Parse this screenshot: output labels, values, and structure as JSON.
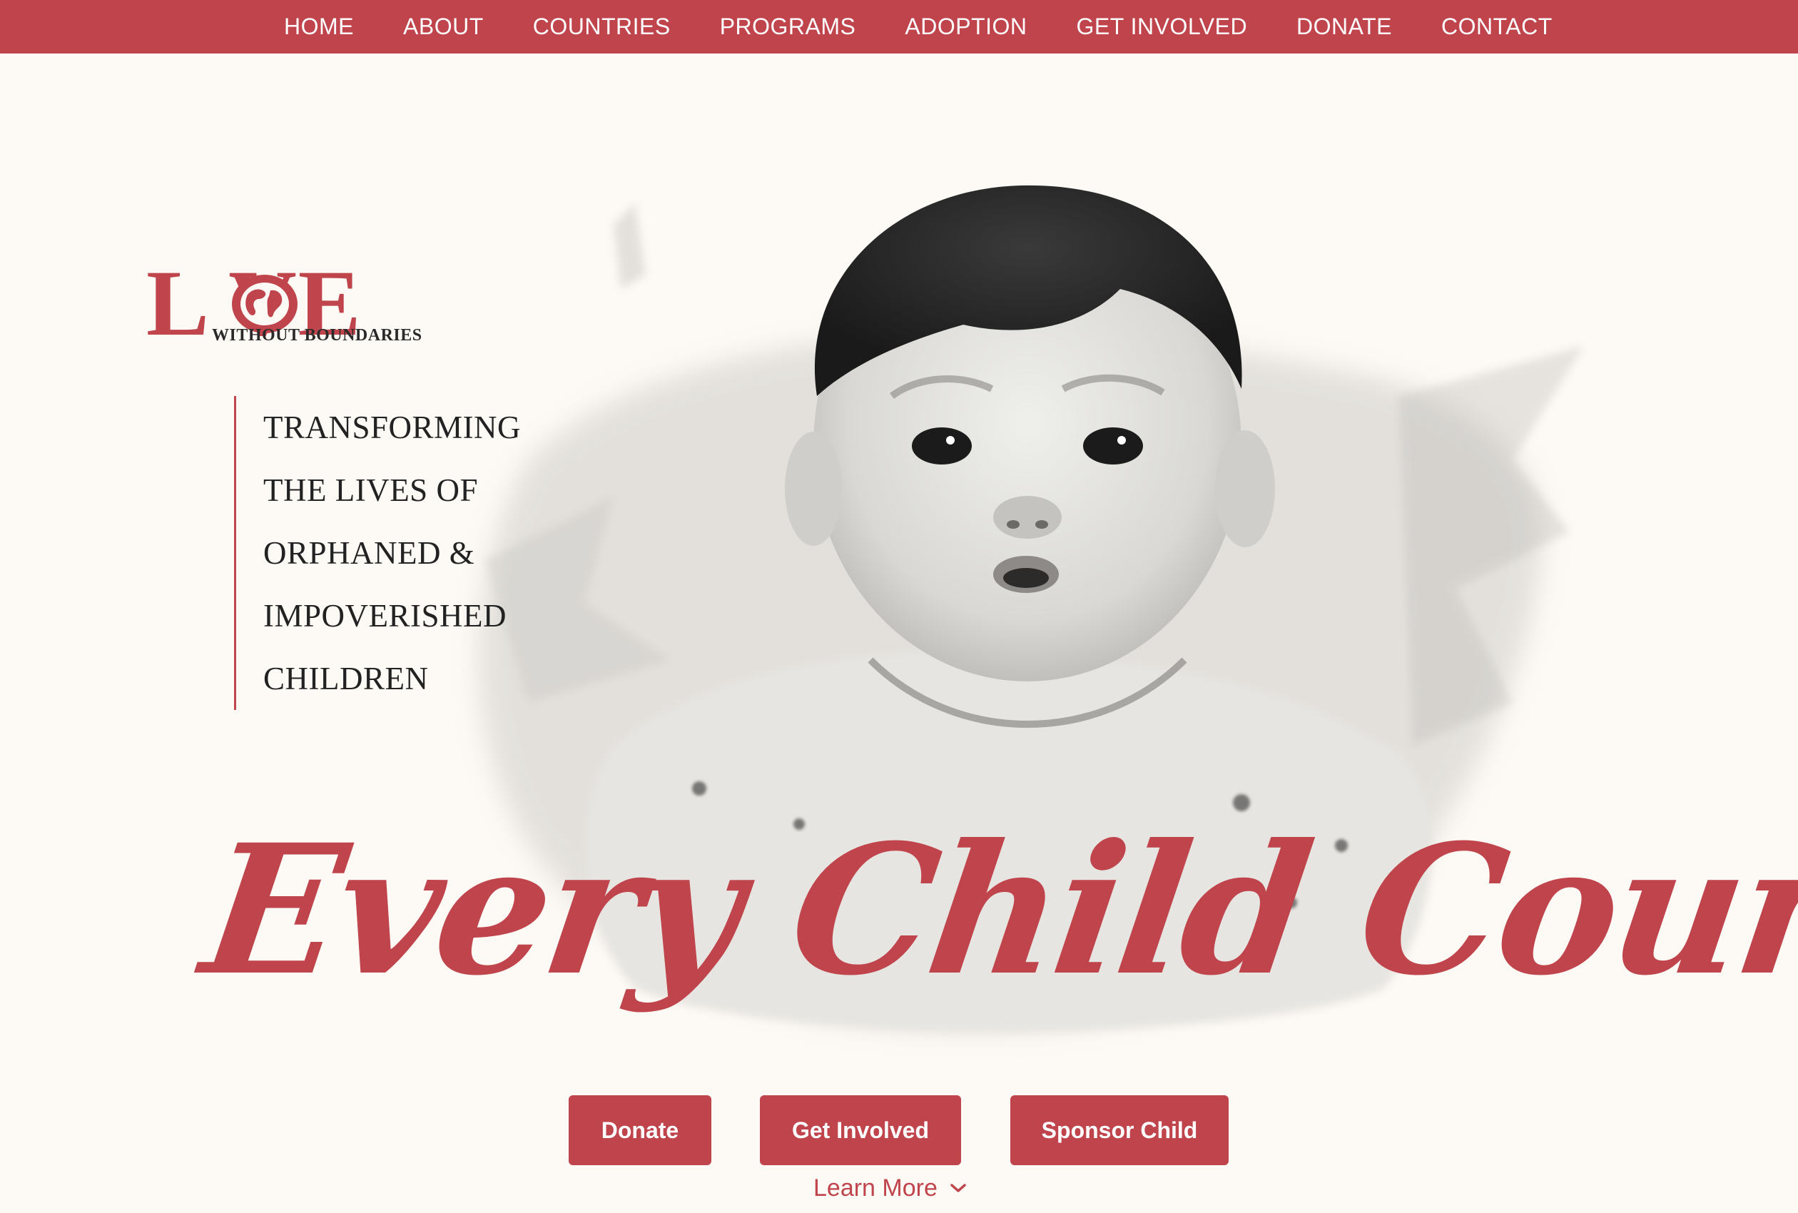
{
  "nav": {
    "items": [
      "HOME",
      "ABOUT",
      "COUNTRIES",
      "PROGRAMS",
      "ADOPTION",
      "GET INVOLVED",
      "DONATE",
      "CONTACT"
    ]
  },
  "logo": {
    "word": "L VE",
    "subtitle": "WITHOUT BOUNDARIES"
  },
  "tagline": [
    "TRANSFORMING",
    "THE LIVES OF",
    "ORPHANED &",
    "IMPOVERISHED",
    "CHILDREN"
  ],
  "headline": "Every Child Counts",
  "buttons": {
    "donate": "Donate",
    "get_involved": "Get Involved",
    "sponsor": "Sponsor Child"
  },
  "learn_more": "Learn More",
  "colors": {
    "brand_red": "#c0444c",
    "background": "#fdf9f4"
  }
}
